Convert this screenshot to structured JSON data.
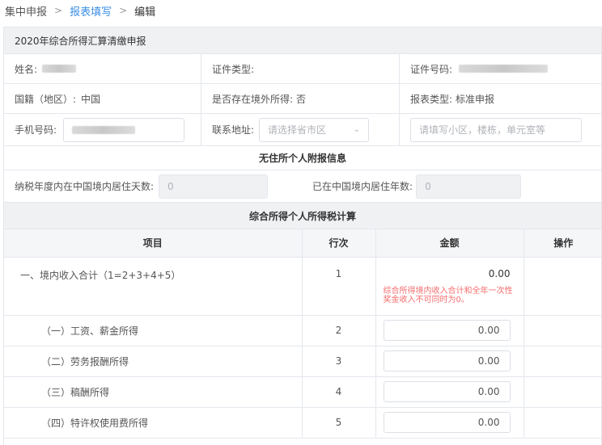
{
  "breadcrumb": {
    "items": [
      "集中申报",
      "报表填写",
      "编辑"
    ],
    "separator": ">"
  },
  "form": {
    "title": "2020年综合所得汇算清缴申报",
    "name_label": "姓名:",
    "id_type_label": "证件类型:",
    "id_no_label": "证件号码:",
    "nationality_label": "国籍（地区）:",
    "nationality_value": "中国",
    "overseas_label": "是否存在境外所得:",
    "overseas_value": "否",
    "report_type_label": "报表类型:",
    "report_type_value": "标准申报",
    "phone_label": "手机号码:",
    "address_label": "联系地址:",
    "address_select_placeholder": "请选择省市区",
    "address_detail_placeholder": "请填写小区，楼栋，单元室等"
  },
  "nonresident": {
    "title": "无住所个人附报信息",
    "days_label": "纳税年度内在中国境内居住天数:",
    "days_value": "0",
    "years_label": "已在中国境内居住年数:",
    "years_value": "0"
  },
  "calc": {
    "title": "综合所得个人所得税计算",
    "headers": {
      "item": "项目",
      "line": "行次",
      "amount": "金额",
      "action": "操作"
    },
    "rows": [
      {
        "item": "一、境内收入合计（1=2+3+4+5）",
        "line": "1",
        "amount": "0.00",
        "warning": "综合所得境内收入合计和全年一次性奖金收入不可同时为0。"
      },
      {
        "item": "（一）工资、薪金所得",
        "line": "2",
        "amount": "0.00"
      },
      {
        "item": "（二）劳务报酬所得",
        "line": "3",
        "amount": "0.00"
      },
      {
        "item": "（三）稿酬所得",
        "line": "4",
        "amount": "0.00"
      },
      {
        "item": "（四）特许权使用费所得",
        "line": "5",
        "amount": "0.00"
      }
    ]
  },
  "colors": {
    "link": "#3a8ee6",
    "warning": "#f56c6c",
    "header_bg": "#f0f1f3"
  }
}
